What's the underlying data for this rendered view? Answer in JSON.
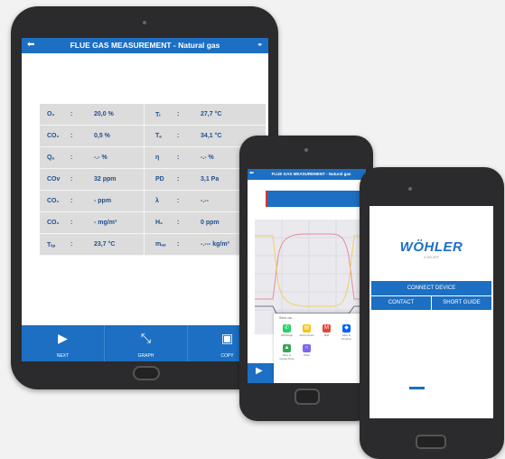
{
  "tablet": {
    "title": "FLUE GAS MEASUREMENT - Natural gas",
    "rows": [
      {
        "l1": "O₂",
        "s1": ":",
        "v1": "20,0  %",
        "l2": "Tₗ",
        "s2": ":",
        "v2": "27,7  °C"
      },
      {
        "l1": "CO₂",
        "s1": ":",
        "v1": "0,5 %",
        "l2": "Tₐ",
        "s2": ":",
        "v2": "34,1  °C"
      },
      {
        "l1": "Qₐ",
        "s1": ":",
        "v1": "-.- %",
        "l2": "η",
        "s2": ":",
        "v2": "-.- %"
      },
      {
        "l1": "COv",
        "s1": ":",
        "v1": "32 ppm",
        "l2": "PD",
        "s2": ":",
        "v2": "3,1  Pa"
      },
      {
        "l1": "CO₁",
        "s1": ":",
        "v1": "- ppm",
        "l2": "λ",
        "s2": ":",
        "v2": "-.--"
      },
      {
        "l1": "CO₂",
        "s1": ":",
        "v1": "- mg/m³",
        "l2": "H₂",
        "s2": ":",
        "v2": "0 ppm"
      },
      {
        "l1": "Tₜₚ",
        "s1": ":",
        "v1": "23,7  °C",
        "l2": "mₐᵤ",
        "s2": ":",
        "v2": "-.--- kg/m³"
      }
    ],
    "buttons": [
      {
        "label": "NEXT",
        "icon": "play-icon"
      },
      {
        "label": "GRAPH",
        "icon": "graph-icon"
      },
      {
        "label": "COPY",
        "icon": "save-icon"
      }
    ]
  },
  "phone1": {
    "title": "FLUE GAS MEASUREMENT - Natural gas",
    "share_title": "Send via...",
    "share_items": [
      {
        "label": "WhatsApp",
        "icon": "whatsapp-icon",
        "color": "#25d366"
      },
      {
        "label": "Add to Notes",
        "icon": "notes-icon",
        "color": "#f5c518"
      },
      {
        "label": "Mail",
        "icon": "mail-icon",
        "color": "#ea4335"
      },
      {
        "label": "Save to Dropbox",
        "icon": "dropbox-icon",
        "color": "#0061fe"
      },
      {
        "label": "Save to Google Drive",
        "icon": "drive-icon",
        "color": "#34a853"
      },
      {
        "label": "Other",
        "icon": "more-icon",
        "color": "#7b68ee"
      }
    ]
  },
  "phone2": {
    "logo": "WÖHLER",
    "subtitle": "A 450 APP",
    "connect_label": "CONNECT DEVICE",
    "contact_label": "CONTACT",
    "guide_label": "SHORT GUIDE"
  },
  "colors": {
    "primary": "#1c6fc2",
    "red": "#d9342b",
    "yellow": "#f0d060",
    "pink": "#e88a9a"
  }
}
